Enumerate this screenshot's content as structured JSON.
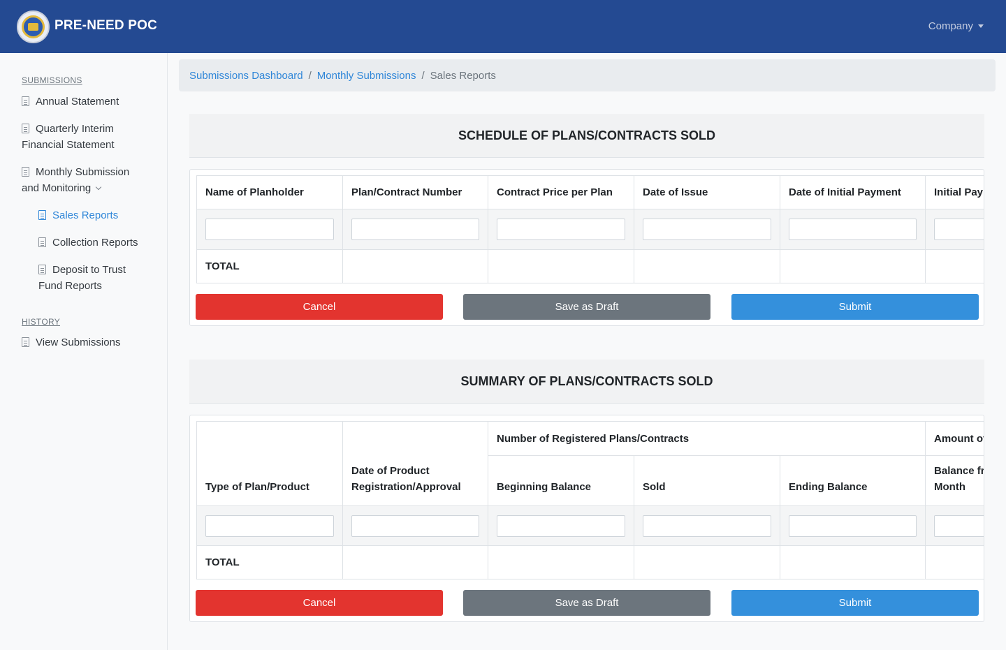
{
  "header": {
    "brand": "PRE-NEED POC",
    "company_menu": "Company"
  },
  "sidebar": {
    "submissions_heading": "SUBMISSIONS",
    "history_heading": "HISTORY",
    "items": [
      {
        "label_line1": "Annual Statement",
        "label_line2": ""
      },
      {
        "label_line1": "Quarterly Interim",
        "label_line2": "Financial Statement"
      },
      {
        "label_line1": "Monthly Submission",
        "label_line2": "and Monitoring"
      },
      {
        "label_line1": "Sales Reports",
        "label_line2": ""
      },
      {
        "label_line1": "Collection Reports",
        "label_line2": ""
      },
      {
        "label_line1": "Deposit to Trust",
        "label_line2": "Fund Reports"
      },
      {
        "label_line1": "View Submissions",
        "label_line2": ""
      }
    ]
  },
  "breadcrumb": {
    "items": [
      "Submissions Dashboard",
      "Monthly Submissions",
      "Sales Reports"
    ]
  },
  "schedule": {
    "title": "SCHEDULE OF PLANS/CONTRACTS SOLD",
    "columns": [
      "Name of Planholder",
      "Plan/Contract Number",
      "Contract Price per Plan",
      "Date of Issue",
      "Date of Initial Payment",
      "Initial Payment"
    ],
    "total_label": "TOTAL",
    "buttons": {
      "cancel": "Cancel",
      "draft": "Save as Draft",
      "submit": "Submit"
    }
  },
  "summary": {
    "title": "SUMMARY OF PLANS/CONTRACTS SOLD",
    "col_type": "Type of Plan/Product",
    "col_date_line1": "Date of Product",
    "col_date_line2": "Registration/Approval",
    "group_registered": "Number of Registered Plans/Contracts",
    "group_amount": "Amount of",
    "sub_beginning": "Beginning Balance",
    "sub_sold": "Sold",
    "sub_ending": "Ending Balance",
    "sub_balance_line1": "Balance from",
    "sub_balance_line2": "Month",
    "total_label": "TOTAL",
    "buttons": {
      "cancel": "Cancel",
      "draft": "Save as Draft",
      "submit": "Submit"
    }
  }
}
